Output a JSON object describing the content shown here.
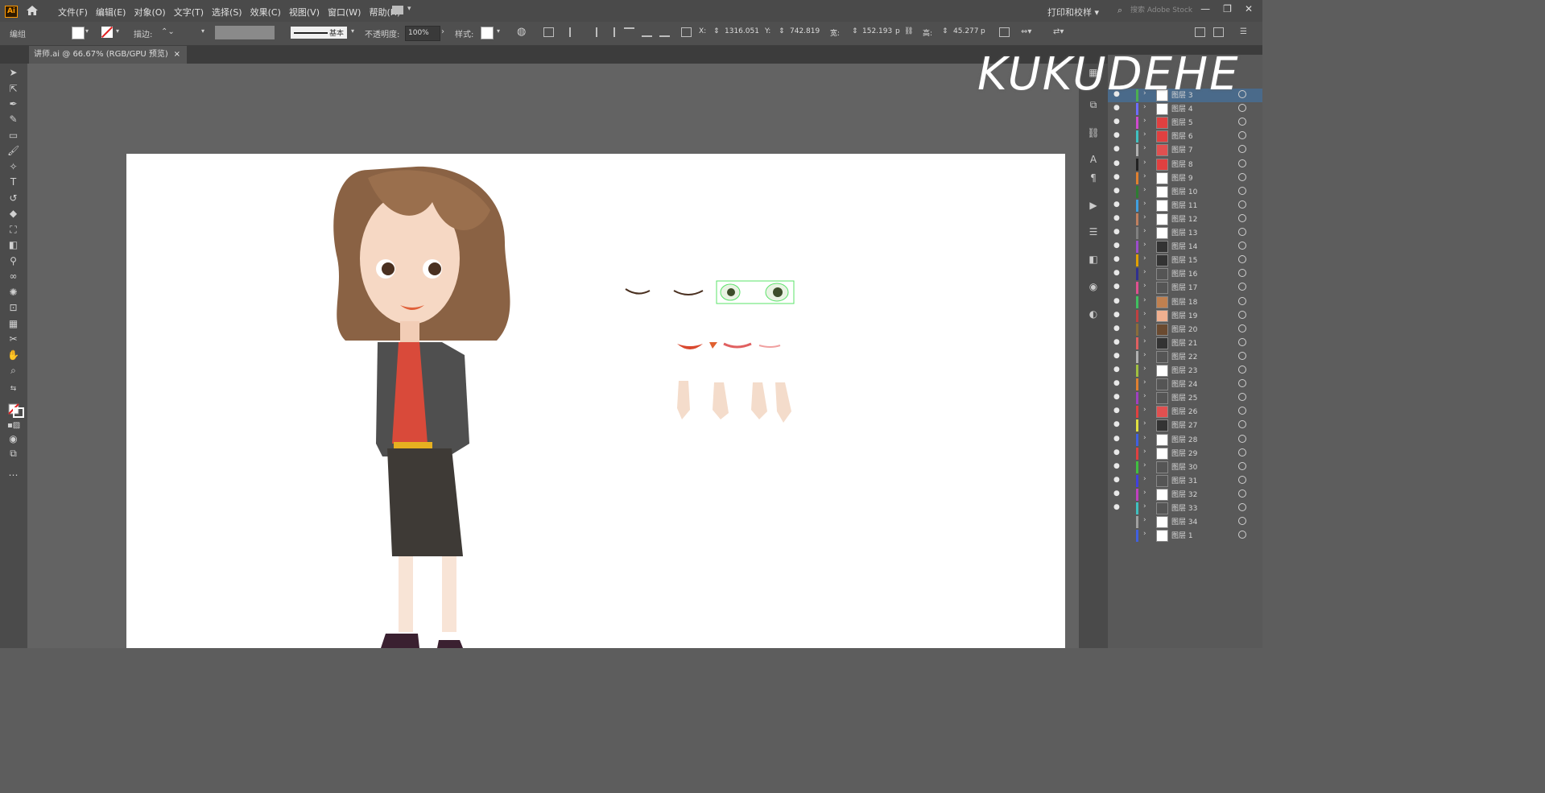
{
  "app": {
    "logo": "Ai"
  },
  "menu": [
    "文件(F)",
    "编辑(E)",
    "对象(O)",
    "文字(T)",
    "选择(S)",
    "效果(C)",
    "视图(V)",
    "窗口(W)",
    "帮助(H)"
  ],
  "menu_right": {
    "preset": "打印和校样",
    "search_placeholder": "搜索 Adobe Stock"
  },
  "window_controls": [
    "—",
    "❐",
    "✕"
  ],
  "controlbar": {
    "selection_label": "编组",
    "stroke_label": "描边:",
    "stroke_profile": "基本",
    "opacity_label": "不透明度:",
    "opacity_value": "100%",
    "style_label": "样式:",
    "x_label": "X:",
    "x_value": "1316.051",
    "y_label": "Y:",
    "y_value": "742.819",
    "w_label": "宽:",
    "w_value": "152.193",
    "w_unit": "p",
    "h_label": "高:",
    "h_value": "45.277",
    "h_unit": "p"
  },
  "document_tab": {
    "title": "讲师.ai @ 66.67% (RGB/GPU 预览)",
    "close": "×"
  },
  "watermark": "KUKUDEHE",
  "layers": [
    {
      "name": "图层 3",
      "color": "#4caf50",
      "visible": true,
      "thumb": "#ffffff"
    },
    {
      "name": "图层 4",
      "color": "#6d6dff",
      "visible": true,
      "thumb": "#ffffff"
    },
    {
      "name": "图层 5",
      "color": "#d04ad0",
      "visible": true,
      "thumb": "#e04040"
    },
    {
      "name": "图层 6",
      "color": "#40c0c0",
      "visible": true,
      "thumb": "#e04040"
    },
    {
      "name": "图层 7",
      "color": "#b0b0b0",
      "visible": true,
      "thumb": "#e05050"
    },
    {
      "name": "图层 8",
      "color": "#222222",
      "visible": true,
      "thumb": "#e04040"
    },
    {
      "name": "图层 9",
      "color": "#e08030",
      "visible": true,
      "thumb": "#ffffff"
    },
    {
      "name": "图层 10",
      "color": "#2e7d32",
      "visible": true,
      "thumb": "#ffffff"
    },
    {
      "name": "图层 11",
      "color": "#40a0e0",
      "visible": true,
      "thumb": "#ffffff"
    },
    {
      "name": "图层 12",
      "color": "#c08060",
      "visible": true,
      "thumb": "#ffffff"
    },
    {
      "name": "图层 13",
      "color": "#808080",
      "visible": true,
      "thumb": "#ffffff"
    },
    {
      "name": "图层 14",
      "color": "#9c4dcc",
      "visible": true,
      "thumb": "#333333"
    },
    {
      "name": "图层 15",
      "color": "#e0a000",
      "visible": true,
      "thumb": "#333333"
    },
    {
      "name": "图层 16",
      "color": "#303090",
      "visible": true,
      "thumb": "#555555"
    },
    {
      "name": "图层 17",
      "color": "#e05090",
      "visible": true,
      "thumb": "#555555"
    },
    {
      "name": "图层 18",
      "color": "#40c060",
      "visible": true,
      "thumb": "#c08050"
    },
    {
      "name": "图层 19",
      "color": "#c04040",
      "visible": true,
      "thumb": "#f0b090"
    },
    {
      "name": "图层 20",
      "color": "#8a6d3b",
      "visible": true,
      "thumb": "#6a4a30"
    },
    {
      "name": "图层 21",
      "color": "#e06060",
      "visible": true,
      "thumb": "#333333"
    },
    {
      "name": "图层 22",
      "color": "#b0b0b0",
      "visible": true,
      "thumb": "#555555"
    },
    {
      "name": "图层 23",
      "color": "#a0c040",
      "visible": true,
      "thumb": "#ffffff"
    },
    {
      "name": "图层 24",
      "color": "#e08030",
      "visible": true,
      "thumb": "#555555"
    },
    {
      "name": "图层 25",
      "color": "#a040c0",
      "visible": true,
      "thumb": "#555555"
    },
    {
      "name": "图层 26",
      "color": "#e04040",
      "visible": true,
      "thumb": "#e05050"
    },
    {
      "name": "图层 27",
      "color": "#e0e040",
      "visible": true,
      "thumb": "#333333"
    },
    {
      "name": "图层 28",
      "color": "#4060e0",
      "visible": true,
      "thumb": "#ffffff"
    },
    {
      "name": "图层 29",
      "color": "#e04040",
      "visible": true,
      "thumb": "#ffffff"
    },
    {
      "name": "图层 30",
      "color": "#40c040",
      "visible": true,
      "thumb": "#555555"
    },
    {
      "name": "图层 31",
      "color": "#4040e0",
      "visible": true,
      "thumb": "#555555"
    },
    {
      "name": "图层 32",
      "color": "#c040c0",
      "visible": true,
      "thumb": "#ffffff"
    },
    {
      "name": "图层 33",
      "color": "#40c0c0",
      "visible": true,
      "thumb": "#555555"
    },
    {
      "name": "图层 34",
      "color": "#a0a0a0",
      "visible": false,
      "thumb": "#ffffff"
    },
    {
      "name": "图层 1",
      "color": "#4060e0",
      "visible": false,
      "thumb": "#ffffff"
    }
  ]
}
